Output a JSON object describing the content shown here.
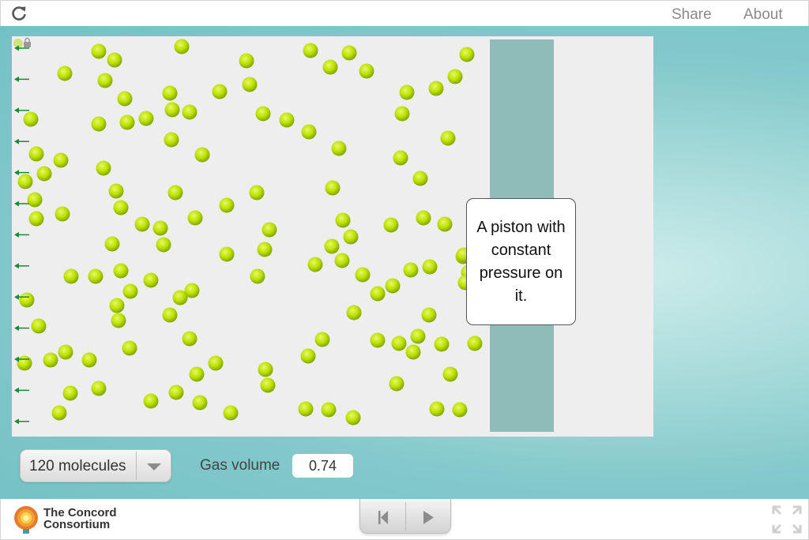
{
  "header": {
    "share_label": "Share",
    "about_label": "About"
  },
  "simulation": {
    "callout_text": "A piston with constant pressure on it.",
    "molecule_color": "#b7e100",
    "piston_color": "#8fbbb8",
    "arrow_color": "#1a8a3a"
  },
  "controls": {
    "molecules_selected": "120 molecules",
    "gas_volume_label": "Gas volume",
    "gas_volume_value": "0.74"
  },
  "footer": {
    "logo_line1": "The Concord",
    "logo_line2": "Consortium"
  }
}
